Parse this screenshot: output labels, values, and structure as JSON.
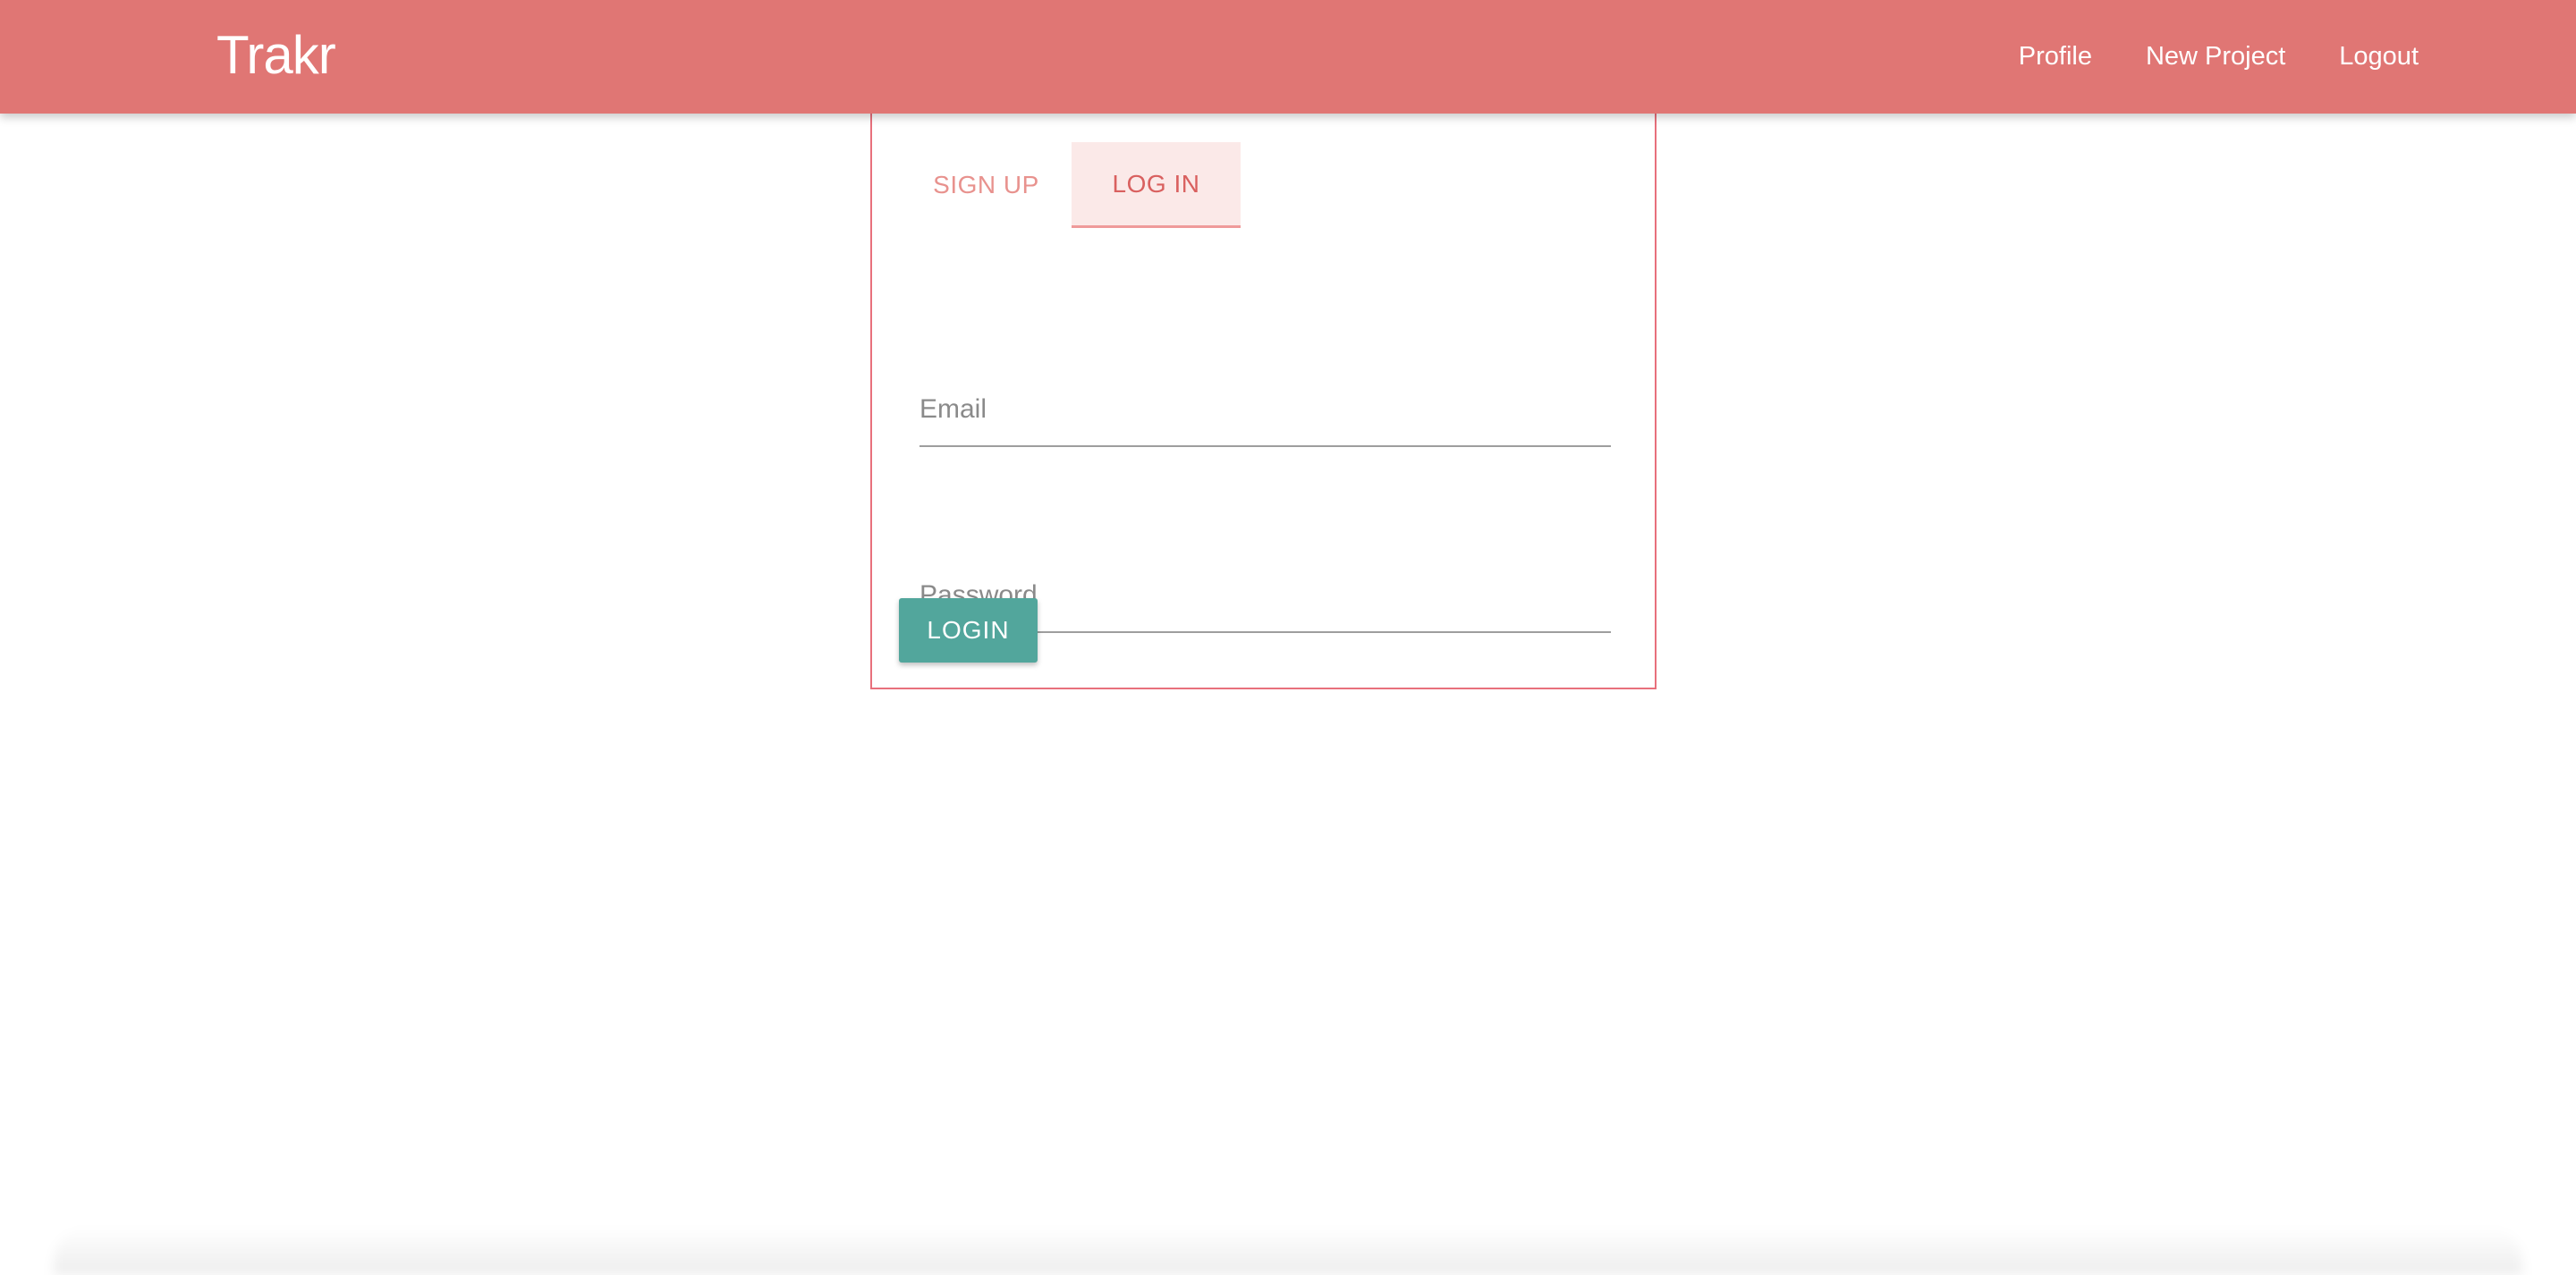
{
  "navbar": {
    "brand": "Trakr",
    "links": [
      {
        "label": "Profile"
      },
      {
        "label": "New Project"
      },
      {
        "label": "Logout"
      }
    ]
  },
  "auth": {
    "tabs": [
      {
        "label": "SIGN UP",
        "active": false
      },
      {
        "label": "LOG IN",
        "active": true
      }
    ],
    "fields": {
      "email": {
        "placeholder": "Email",
        "value": ""
      },
      "password": {
        "placeholder": "Password",
        "value": ""
      }
    },
    "submit_label": "LOGIN"
  },
  "colors": {
    "navbar": "#e07674",
    "card_border": "#e8707c",
    "active_tab_bg": "#fbe9e8",
    "button": "#52a69c"
  }
}
